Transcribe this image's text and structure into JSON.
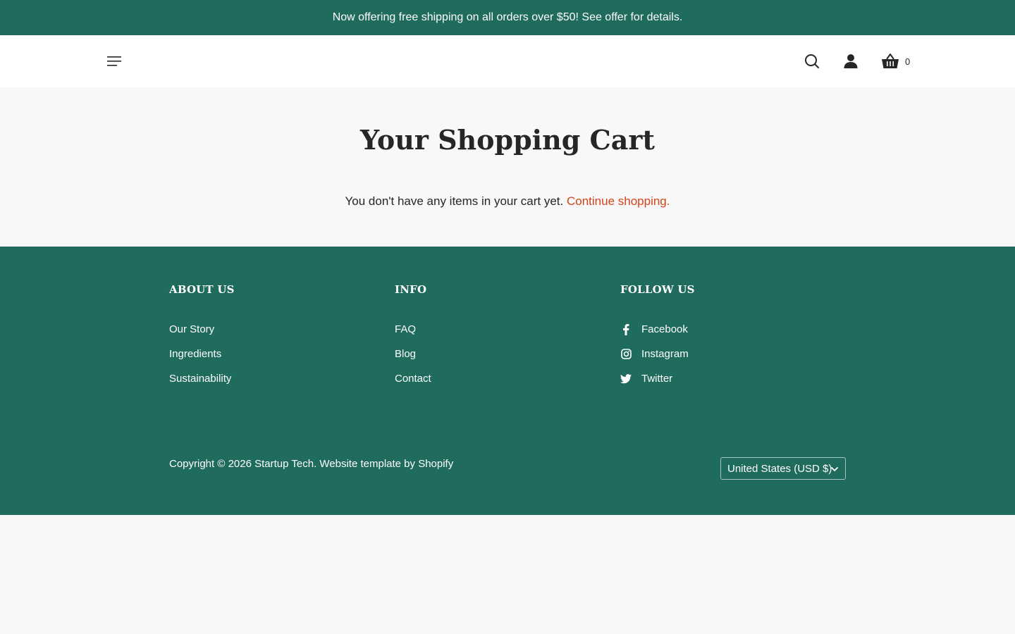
{
  "announcement": {
    "text": "Now offering free shipping on all orders over $50! See offer for details."
  },
  "header": {
    "cart_count": "0",
    "icons": [
      "menu-icon",
      "search-icon",
      "account-icon",
      "cart-basket-icon"
    ]
  },
  "main": {
    "title": "Your Shopping Cart",
    "empty_message": "You don't have any items in your cart yet.",
    "continue_link": "Continue shopping."
  },
  "footer": {
    "columns": [
      {
        "heading": "ABOUT US",
        "links": [
          "Our Story",
          "Ingredients",
          "Sustainability"
        ]
      },
      {
        "heading": "INFO",
        "links": [
          "FAQ",
          "Blog",
          "Contact"
        ]
      },
      {
        "heading": "FOLLOW US",
        "links": [
          "Facebook",
          "Instagram",
          "Twitter"
        ]
      }
    ],
    "copyright": "Copyright © 2026 Startup Tech. Website template by Shopify",
    "currency": "United States (USD $)"
  },
  "colors": {
    "brand_green": "#1f6b5d",
    "accent_orange": "#d4441a",
    "background": "#f8f8f8",
    "text": "#262626"
  }
}
